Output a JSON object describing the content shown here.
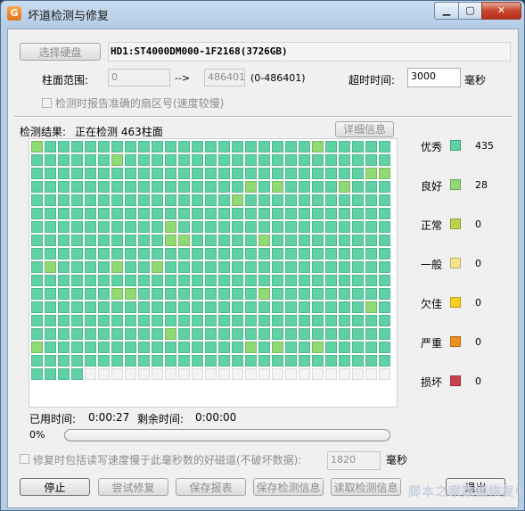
{
  "window": {
    "title": "坏道检测与修复",
    "app_icon": "G",
    "min_label": "▁",
    "max_label": "▢",
    "close_label": "✕"
  },
  "top": {
    "select_disk_label": "选择硬盘",
    "disk_name": "HD1:ST4000DM000-1F2168(3726GB)",
    "cyl_range_label": "柱面范围:",
    "cyl_start": "0",
    "arrow": "-->",
    "cyl_end": "486401",
    "cyl_range_hint": "(0-486401)",
    "timeout_label": "超时时间:",
    "timeout_value": "3000",
    "timeout_unit": "毫秒",
    "report_sector_label": "检测时报告准确的扇区号(速度较慢)"
  },
  "result": {
    "label": "检测结果:",
    "status": "正在检测  463柱面",
    "details_button": "详细信息"
  },
  "grid": {
    "columns": 27,
    "rows": 18,
    "completed_rows": 15,
    "total_done": 463,
    "good_cells": [
      [
        0,
        0
      ],
      [
        0,
        21
      ],
      [
        1,
        6
      ],
      [
        2,
        25
      ],
      [
        2,
        26
      ],
      [
        3,
        16
      ],
      [
        3,
        18
      ],
      [
        3,
        23
      ],
      [
        4,
        15
      ],
      [
        6,
        10
      ],
      [
        7,
        10
      ],
      [
        7,
        11
      ],
      [
        7,
        17
      ],
      [
        9,
        1
      ],
      [
        9,
        6
      ],
      [
        9,
        9
      ],
      [
        11,
        6
      ],
      [
        11,
        7
      ],
      [
        11,
        17
      ],
      [
        12,
        25
      ],
      [
        14,
        10
      ],
      [
        15,
        0
      ],
      [
        15,
        16
      ],
      [
        15,
        18
      ],
      [
        15,
        21
      ]
    ]
  },
  "legend": [
    {
      "label": "优秀",
      "color": "#5fd1a4",
      "count": "435"
    },
    {
      "label": "良好",
      "color": "#8fda74",
      "count": "28"
    },
    {
      "label": "正常",
      "color": "#bfd14a",
      "count": "0"
    },
    {
      "label": "一般",
      "color": "#f7e38c",
      "count": "0"
    },
    {
      "label": "欠佳",
      "color": "#f9d020",
      "count": "0"
    },
    {
      "label": "严重",
      "color": "#eb8f1a",
      "count": "0"
    },
    {
      "label": "损坏",
      "color": "#c94050",
      "count": "0"
    }
  ],
  "timing": {
    "elapsed_label": "已用时间:",
    "elapsed": "0:00:27",
    "remaining_label": "剩余时间:",
    "remaining": "0:00:00"
  },
  "progress": {
    "label": "0%",
    "fraction": 0
  },
  "repair": {
    "label": "修复时包括读写速度慢于此毫秒数的好磁道(不破坏数据):",
    "value": "1820",
    "unit": "毫秒"
  },
  "buttons": {
    "stop": "停止",
    "try_repair": "尝试修复",
    "save_report": "保存报表",
    "save_info": "保存检测信息",
    "load_info": "读取检测信息",
    "exit": "退出"
  },
  "watermark": "脚本之家数据恢复中心"
}
